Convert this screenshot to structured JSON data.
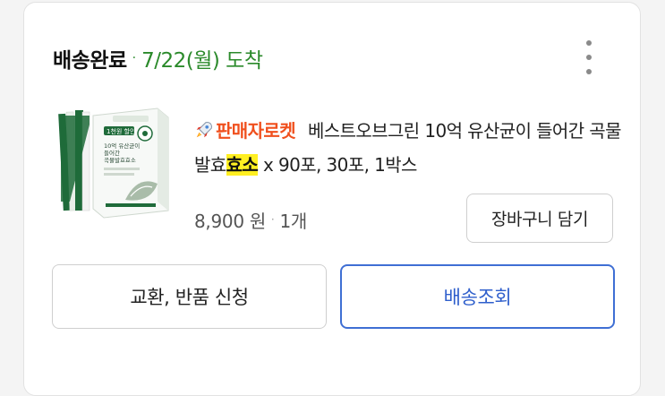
{
  "order": {
    "status": "배송완료",
    "separator": "·",
    "delivery_date": "7/22(월) 도착"
  },
  "product": {
    "badge_icon": "rocket-icon",
    "badge_label": "판매자로켓",
    "title_before": "베스트오브그린 10억 유산균이 들어간 곡물발효",
    "title_highlight": "효소",
    "title_after": " x 90포, 30포, 1박스",
    "highlight_color": "#ffef22",
    "thumbnail": {
      "box_tag": "1천원 할인",
      "box_text": "10억 유산균이 들어간 곡물발효효소"
    }
  },
  "price": {
    "amount": "8,900 원",
    "separator": "·",
    "quantity": "1개"
  },
  "actions": {
    "add_to_cart": "장바구니 담기",
    "exchange_return": "교환, 반품 신청",
    "track_delivery": "배송조회"
  },
  "colors": {
    "status_green": "#2b8a2b",
    "rocket_orange": "#f0501e",
    "track_blue": "#3f6fd4",
    "product_green": "#1f6b3a"
  },
  "icons": {
    "more": "more-vertical-icon"
  }
}
